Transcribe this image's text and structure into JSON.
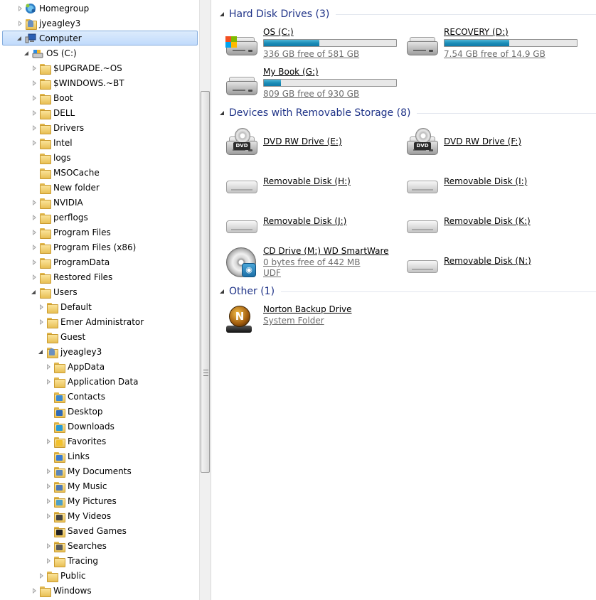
{
  "nav": {
    "items": [
      {
        "label": "Homegroup",
        "level": 2,
        "arrow": "col",
        "icon": "homegroup-icon"
      },
      {
        "label": "jyeagley3",
        "level": 2,
        "arrow": "col",
        "icon": "user-folder-icon"
      },
      {
        "label": "Computer",
        "level": 2,
        "arrow": "exp",
        "icon": "computer-icon",
        "selected": true
      },
      {
        "label": "OS (C:)",
        "level": 3,
        "arrow": "exp",
        "icon": "drive-icon"
      },
      {
        "label": "$UPGRADE.~OS",
        "level": 4,
        "arrow": "col",
        "icon": "folder-icon"
      },
      {
        "label": "$WINDOWS.~BT",
        "level": 4,
        "arrow": "col",
        "icon": "folder-icon"
      },
      {
        "label": "Boot",
        "level": 4,
        "arrow": "col",
        "icon": "folder-icon"
      },
      {
        "label": "DELL",
        "level": 4,
        "arrow": "col",
        "icon": "folder-icon"
      },
      {
        "label": "Drivers",
        "level": 4,
        "arrow": "col",
        "icon": "folder-icon"
      },
      {
        "label": "Intel",
        "level": 4,
        "arrow": "col",
        "icon": "folder-icon"
      },
      {
        "label": "logs",
        "level": 4,
        "arrow": "none",
        "icon": "folder-icon"
      },
      {
        "label": "MSOCache",
        "level": 4,
        "arrow": "none",
        "icon": "folder-icon"
      },
      {
        "label": "New folder",
        "level": 4,
        "arrow": "none",
        "icon": "folder-icon"
      },
      {
        "label": "NVIDIA",
        "level": 4,
        "arrow": "col",
        "icon": "folder-icon"
      },
      {
        "label": "perflogs",
        "level": 4,
        "arrow": "col",
        "icon": "folder-icon"
      },
      {
        "label": "Program Files",
        "level": 4,
        "arrow": "col",
        "icon": "folder-icon"
      },
      {
        "label": "Program Files (x86)",
        "level": 4,
        "arrow": "col",
        "icon": "folder-icon"
      },
      {
        "label": "ProgramData",
        "level": 4,
        "arrow": "col",
        "icon": "folder-icon"
      },
      {
        "label": "Restored Files",
        "level": 4,
        "arrow": "col",
        "icon": "folder-icon"
      },
      {
        "label": "Users",
        "level": 4,
        "arrow": "exp",
        "icon": "folder-icon"
      },
      {
        "label": "Default",
        "level": 5,
        "arrow": "col",
        "icon": "folder-icon"
      },
      {
        "label": "Emer Administrator",
        "level": 5,
        "arrow": "col",
        "icon": "folder-icon"
      },
      {
        "label": "Guest",
        "level": 5,
        "arrow": "none",
        "icon": "folder-icon"
      },
      {
        "label": "jyeagley3",
        "level": 5,
        "arrow": "exp",
        "icon": "user-folder-icon"
      },
      {
        "label": "AppData",
        "level": 6,
        "arrow": "col",
        "icon": "folder-icon"
      },
      {
        "label": "Application Data",
        "level": 6,
        "arrow": "col",
        "icon": "folder-icon"
      },
      {
        "label": "Contacts",
        "level": 6,
        "arrow": "none",
        "icon": "contacts-folder-icon"
      },
      {
        "label": "Desktop",
        "level": 6,
        "arrow": "none",
        "icon": "desktop-folder-icon"
      },
      {
        "label": "Downloads",
        "level": 6,
        "arrow": "none",
        "icon": "downloads-folder-icon"
      },
      {
        "label": "Favorites",
        "level": 6,
        "arrow": "col",
        "icon": "favorites-folder-icon"
      },
      {
        "label": "Links",
        "level": 6,
        "arrow": "none",
        "icon": "links-folder-icon"
      },
      {
        "label": "My Documents",
        "level": 6,
        "arrow": "col",
        "icon": "documents-folder-icon"
      },
      {
        "label": "My Music",
        "level": 6,
        "arrow": "col",
        "icon": "music-folder-icon"
      },
      {
        "label": "My Pictures",
        "level": 6,
        "arrow": "col",
        "icon": "pictures-folder-icon"
      },
      {
        "label": "My Videos",
        "level": 6,
        "arrow": "col",
        "icon": "videos-folder-icon"
      },
      {
        "label": "Saved Games",
        "level": 6,
        "arrow": "none",
        "icon": "saved-games-folder-icon"
      },
      {
        "label": "Searches",
        "level": 6,
        "arrow": "col",
        "icon": "searches-folder-icon"
      },
      {
        "label": "Tracing",
        "level": 6,
        "arrow": "col",
        "icon": "folder-icon"
      },
      {
        "label": "Public",
        "level": 5,
        "arrow": "col",
        "icon": "folder-icon"
      },
      {
        "label": "Windows",
        "level": 4,
        "arrow": "col",
        "icon": "folder-icon"
      }
    ]
  },
  "content": {
    "groups": {
      "hdd": {
        "title": "Hard Disk Drives (3)"
      },
      "removable": {
        "title": "Devices with Removable Storage (8)"
      },
      "other": {
        "title": "Other (1)"
      }
    },
    "hdd": [
      {
        "name": "OS (C:)",
        "free": "336 GB free of 581 GB",
        "used_fraction": 0.42,
        "icon": "os-drive-icon"
      },
      {
        "name": "RECOVERY (D:)",
        "free": "7.54 GB free of 14.9 GB",
        "used_fraction": 0.49,
        "icon": "hard-drive-icon"
      },
      {
        "name": "My Book (G:)",
        "free": "809 GB free of 930 GB",
        "used_fraction": 0.13,
        "icon": "hard-drive-icon"
      }
    ],
    "removable": [
      {
        "name": "DVD RW Drive (E:)",
        "icon": "dvd-drive-icon",
        "badge": "DVD"
      },
      {
        "name": "DVD RW Drive (F:)",
        "icon": "dvd-drive-icon",
        "badge": "DVD"
      },
      {
        "name": "Removable Disk (H:)",
        "icon": "removable-disk-icon"
      },
      {
        "name": "Removable Disk (I:)",
        "icon": "removable-disk-icon"
      },
      {
        "name": "Removable Disk (J:)",
        "icon": "removable-disk-icon"
      },
      {
        "name": "Removable Disk (K:)",
        "icon": "removable-disk-icon"
      },
      {
        "name": "CD Drive (M:) WD SmartWare",
        "free": "0 bytes free of 442 MB",
        "fs": "UDF",
        "icon": "cd-drive-icon"
      },
      {
        "name": "Removable Disk (N:)",
        "icon": "removable-disk-icon"
      }
    ],
    "other": [
      {
        "name": "Norton Backup Drive",
        "sub": "System Folder",
        "icon": "norton-backup-icon",
        "glyph": "N"
      }
    ]
  },
  "colors": {
    "group_title": "#1e3287",
    "selection": "#c1dbfc",
    "bar_fill": "#1b8db8"
  }
}
